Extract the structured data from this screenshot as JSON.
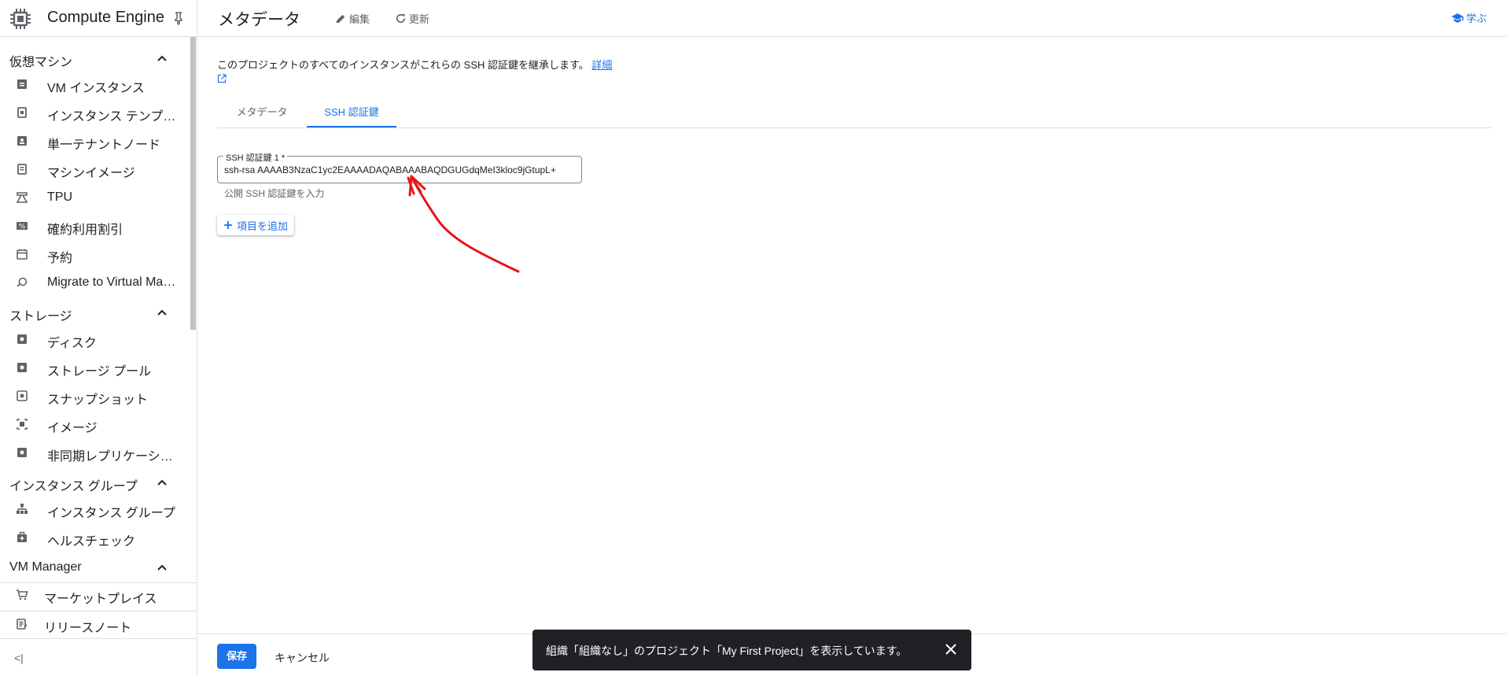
{
  "header": {
    "product_title": "Compute Engine"
  },
  "sidebar": {
    "sections": [
      {
        "label": "仮想マシン"
      },
      {
        "label": "ストレージ"
      },
      {
        "label": "インスタンス グループ"
      },
      {
        "label": "VM Manager"
      }
    ],
    "vm_items": [
      {
        "label": "VM インスタンス",
        "icon": "vm-instance-icon"
      },
      {
        "label": "インスタンス テンプレ...",
        "icon": "template-icon"
      },
      {
        "label": "単一テナントノード",
        "icon": "sole-tenant-icon"
      },
      {
        "label": "マシンイメージ",
        "icon": "machine-image-icon"
      },
      {
        "label": "TPU",
        "icon": "tpu-icon"
      },
      {
        "label": "確約利用割引",
        "icon": "percent-icon"
      },
      {
        "label": "予約",
        "icon": "calendar-icon"
      },
      {
        "label": "Migrate to Virtual Mach...",
        "icon": "migrate-icon"
      }
    ],
    "storage_items": [
      {
        "label": "ディスク",
        "icon": "disk-icon"
      },
      {
        "label": "ストレージ プール",
        "icon": "storage-pool-icon"
      },
      {
        "label": "スナップショット",
        "icon": "snapshot-icon"
      },
      {
        "label": "イメージ",
        "icon": "image-icon"
      },
      {
        "label": "非同期レプリケーション",
        "icon": "replication-icon"
      }
    ],
    "group_items": [
      {
        "label": "インスタンス グループ",
        "icon": "instance-group-icon"
      },
      {
        "label": "ヘルスチェック",
        "icon": "health-check-icon"
      }
    ],
    "bottom_items": [
      {
        "label": "マーケットプレイス",
        "icon": "cart-icon"
      },
      {
        "label": "リリースノート",
        "icon": "release-notes-icon"
      }
    ],
    "collapse_label": "<|"
  },
  "topbar": {
    "page_title": "メタデータ",
    "edit_label": "編集",
    "refresh_label": "更新",
    "learn_label": "学ぶ"
  },
  "main": {
    "description": "このプロジェクトのすべてのインスタンスがこれらの SSH 認証鍵を継承します。",
    "details_link": "詳細",
    "tabs": [
      {
        "label": "メタデータ",
        "active": false
      },
      {
        "label": "SSH 認証鍵",
        "active": true
      }
    ],
    "ssh_field": {
      "label": "SSH 認証鍵 1 *",
      "value": "ssh-rsa AAAAB3NzaC1yc2EAAAADAQABAAABAQDGUGdqMeI3kloc9jGtupL+",
      "hint": "公開 SSH 認証鍵を入力"
    },
    "add_item_label": "項目を追加"
  },
  "footer": {
    "save_label": "保存",
    "cancel_label": "キャンセル"
  },
  "snackbar": {
    "message": "組織「組織なし」のプロジェクト「My First Project」を表示しています。"
  },
  "colors": {
    "accent": "#1a73e8",
    "annotation": "#e8141a",
    "snackbar_bg": "#202124"
  }
}
